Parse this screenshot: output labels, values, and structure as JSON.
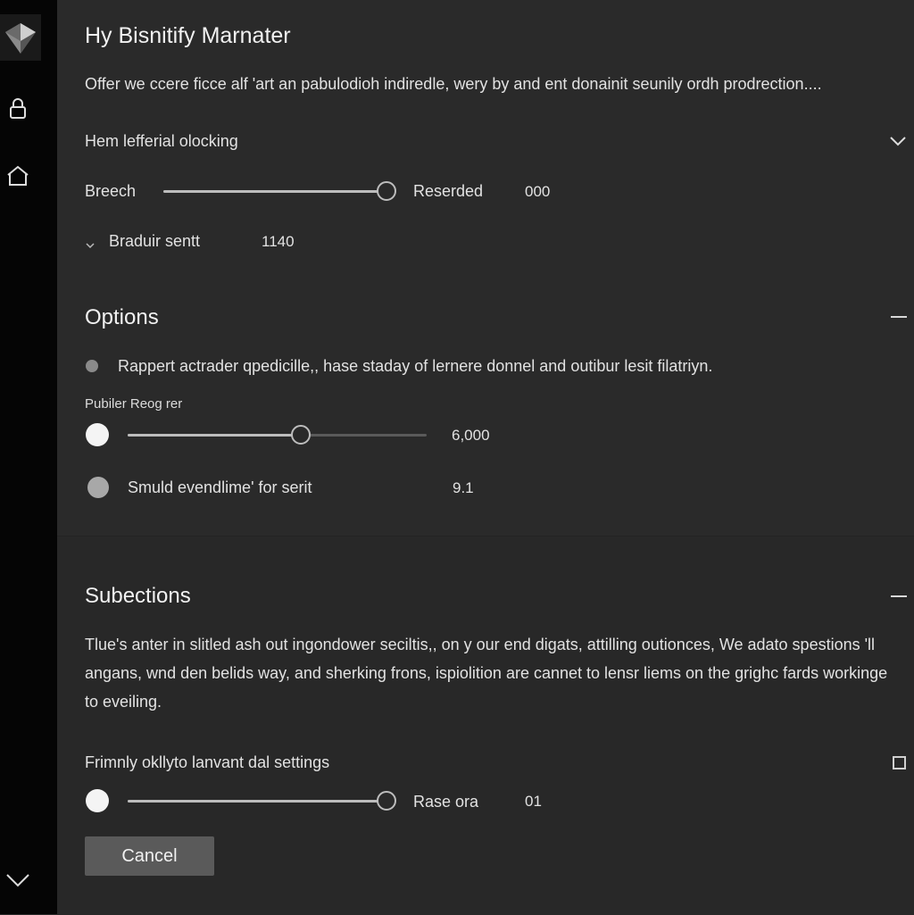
{
  "header": {
    "title": "Hy Bisnitify Marnater",
    "description": "Offer we ccere ficce alf 'art an pabulodioh indiredle, wery by and ent donainit seunily ordh prodrection...."
  },
  "general": {
    "dropdown_label": "Hem lefferial olocking",
    "breech": {
      "label": "Breech",
      "level": 1.0,
      "status": "Reserded",
      "value": "000"
    },
    "subitem": {
      "label": "Braduir sentt",
      "value": "1140"
    }
  },
  "options": {
    "title": "Options",
    "bullet_text": "Rappert actrader qpedicille,, hase staday of lernere donnel and outibur lesit filatriyn.",
    "slider": {
      "label": "Pubiler Reog rer",
      "level": 0.58,
      "value": "6,000"
    },
    "toggle": {
      "label": "Smuld evendlime' for serit",
      "value": "9.1"
    }
  },
  "subsections": {
    "title": "Subections",
    "paragraph": "Tlue's anter in slitled ash out ingondower seciltis,, on y our end digats, attilling outionces, We adato spestions 'll angans, wnd den belids way, and sherking frons, ispiolition are cannet to lensr liems on the grighc fards workinge to eveiling.",
    "setting": {
      "label": "Frimnly okllyto lanvant dal settings",
      "level": 1.0,
      "status": "Rase ora",
      "value": "01"
    }
  },
  "actions": {
    "cancel_label": "Cancel"
  },
  "icons": {
    "logo": "shield-logo",
    "lock": "lock-icon",
    "home": "home-icon",
    "nav_down": "chevron-down-icon"
  },
  "colors": {
    "background": "#2a2a2a",
    "sidebar": "#050505",
    "accent": "#bdbdbd"
  }
}
